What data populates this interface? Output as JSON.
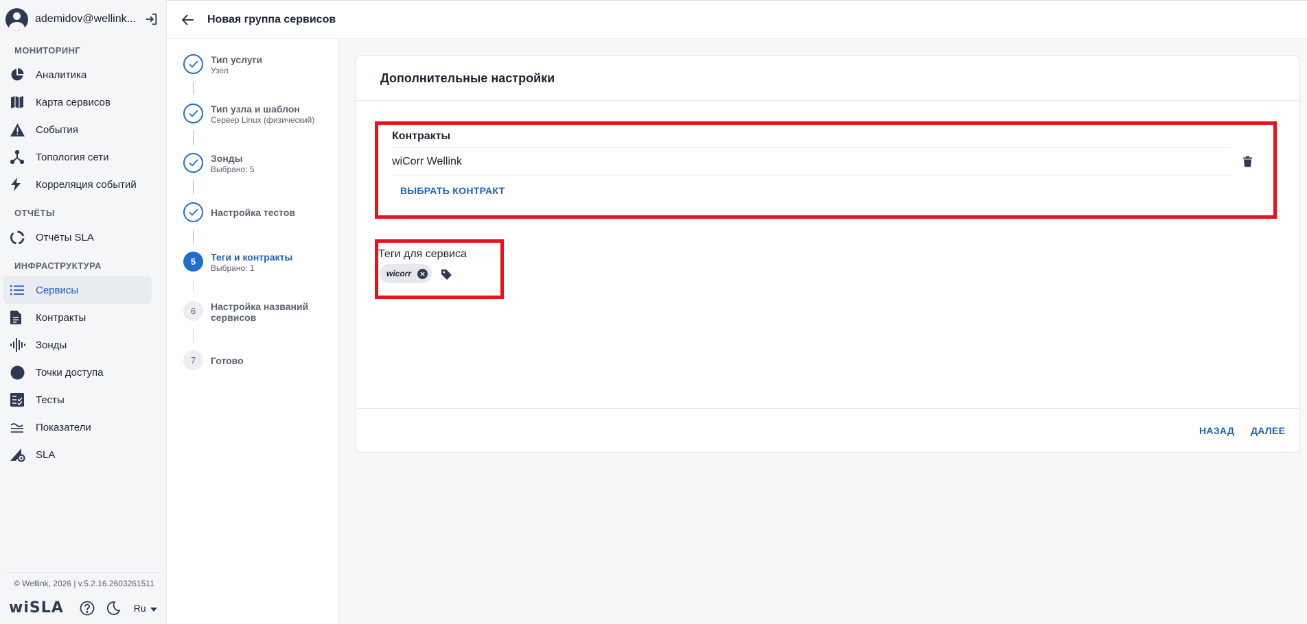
{
  "user": {
    "name": "ademidov@wellink..."
  },
  "sidebar": {
    "sections": [
      {
        "title": "МОНИТОРИНГ"
      },
      {
        "title": "ОТЧЁТЫ"
      },
      {
        "title": "ИНФРАСТРУКТУРА"
      }
    ],
    "items": [
      {
        "label": "Аналитика",
        "icon": "pie-chart-icon"
      },
      {
        "label": "Карта сервисов",
        "icon": "map-icon"
      },
      {
        "label": "События",
        "icon": "warning-icon"
      },
      {
        "label": "Топология сети",
        "icon": "topology-icon"
      },
      {
        "label": "Корреляция событий",
        "icon": "bolt-icon"
      },
      {
        "label": "Отчёты SLA",
        "icon": "donut-icon"
      },
      {
        "label": "Сервисы",
        "icon": "list-icon",
        "active": true
      },
      {
        "label": "Контракты",
        "icon": "document-icon"
      },
      {
        "label": "Зонды",
        "icon": "probe-icon"
      },
      {
        "label": "Точки доступа",
        "icon": "circle-icon"
      },
      {
        "label": "Тесты",
        "icon": "checklist-icon"
      },
      {
        "label": "Показатели",
        "icon": "metrics-icon"
      },
      {
        "label": "SLA",
        "icon": "sla-gear-icon"
      }
    ],
    "footer": {
      "version": "© Wellink, 2026 | v.5.2.16.2603261511",
      "logo": "wiSLA",
      "lang": "Ru"
    }
  },
  "header": {
    "title": "Новая группа сервисов"
  },
  "stepper": {
    "steps": [
      {
        "label": "Тип услуги",
        "sub": "Узел",
        "state": "done"
      },
      {
        "label": "Тип узла и шаблон",
        "sub": "Сервер Linux (физический)",
        "state": "done"
      },
      {
        "label": "Зонды",
        "sub": "Выбрано: 5",
        "state": "done"
      },
      {
        "label": "Настройка тестов",
        "sub": "",
        "state": "done"
      },
      {
        "label": "Теги и контракты",
        "sub": "Выбрано: 1",
        "state": "active",
        "num": "5"
      },
      {
        "label": "Настройка названий сервисов",
        "sub": "",
        "state": "todo",
        "num": "6"
      },
      {
        "label": "Готово",
        "sub": "",
        "state": "todo",
        "num": "7"
      }
    ]
  },
  "card": {
    "title": "Дополнительные настройки",
    "contracts": {
      "title": "Контракты",
      "items": [
        "wiCorr Wellink"
      ],
      "choose_label": "ВЫБРАТЬ КОНТРАКТ"
    },
    "tags": {
      "title": "Теги для сервиса",
      "chips": [
        "wicorr"
      ]
    },
    "back_label": "НАЗАД",
    "next_label": "ДАЛЕЕ"
  },
  "colors": {
    "accent": "#1f6cc9",
    "highlight": "#e8121b"
  }
}
